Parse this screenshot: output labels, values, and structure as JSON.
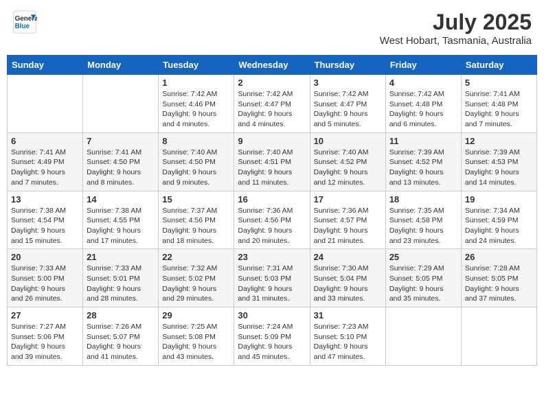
{
  "header": {
    "logo_general": "General",
    "logo_blue": "Blue",
    "month_year": "July 2025",
    "location": "West Hobart, Tasmania, Australia"
  },
  "weekdays": [
    "Sunday",
    "Monday",
    "Tuesday",
    "Wednesday",
    "Thursday",
    "Friday",
    "Saturday"
  ],
  "weeks": [
    [
      {
        "day": "",
        "info": ""
      },
      {
        "day": "",
        "info": ""
      },
      {
        "day": "1",
        "info": "Sunrise: 7:42 AM\nSunset: 4:46 PM\nDaylight: 9 hours and 4 minutes."
      },
      {
        "day": "2",
        "info": "Sunrise: 7:42 AM\nSunset: 4:47 PM\nDaylight: 9 hours and 4 minutes."
      },
      {
        "day": "3",
        "info": "Sunrise: 7:42 AM\nSunset: 4:47 PM\nDaylight: 9 hours and 5 minutes."
      },
      {
        "day": "4",
        "info": "Sunrise: 7:42 AM\nSunset: 4:48 PM\nDaylight: 9 hours and 6 minutes."
      },
      {
        "day": "5",
        "info": "Sunrise: 7:41 AM\nSunset: 4:48 PM\nDaylight: 9 hours and 7 minutes."
      }
    ],
    [
      {
        "day": "6",
        "info": "Sunrise: 7:41 AM\nSunset: 4:49 PM\nDaylight: 9 hours and 7 minutes."
      },
      {
        "day": "7",
        "info": "Sunrise: 7:41 AM\nSunset: 4:50 PM\nDaylight: 9 hours and 8 minutes."
      },
      {
        "day": "8",
        "info": "Sunrise: 7:40 AM\nSunset: 4:50 PM\nDaylight: 9 hours and 9 minutes."
      },
      {
        "day": "9",
        "info": "Sunrise: 7:40 AM\nSunset: 4:51 PM\nDaylight: 9 hours and 11 minutes."
      },
      {
        "day": "10",
        "info": "Sunrise: 7:40 AM\nSunset: 4:52 PM\nDaylight: 9 hours and 12 minutes."
      },
      {
        "day": "11",
        "info": "Sunrise: 7:39 AM\nSunset: 4:52 PM\nDaylight: 9 hours and 13 minutes."
      },
      {
        "day": "12",
        "info": "Sunrise: 7:39 AM\nSunset: 4:53 PM\nDaylight: 9 hours and 14 minutes."
      }
    ],
    [
      {
        "day": "13",
        "info": "Sunrise: 7:38 AM\nSunset: 4:54 PM\nDaylight: 9 hours and 15 minutes."
      },
      {
        "day": "14",
        "info": "Sunrise: 7:38 AM\nSunset: 4:55 PM\nDaylight: 9 hours and 17 minutes."
      },
      {
        "day": "15",
        "info": "Sunrise: 7:37 AM\nSunset: 4:56 PM\nDaylight: 9 hours and 18 minutes."
      },
      {
        "day": "16",
        "info": "Sunrise: 7:36 AM\nSunset: 4:56 PM\nDaylight: 9 hours and 20 minutes."
      },
      {
        "day": "17",
        "info": "Sunrise: 7:36 AM\nSunset: 4:57 PM\nDaylight: 9 hours and 21 minutes."
      },
      {
        "day": "18",
        "info": "Sunrise: 7:35 AM\nSunset: 4:58 PM\nDaylight: 9 hours and 23 minutes."
      },
      {
        "day": "19",
        "info": "Sunrise: 7:34 AM\nSunset: 4:59 PM\nDaylight: 9 hours and 24 minutes."
      }
    ],
    [
      {
        "day": "20",
        "info": "Sunrise: 7:33 AM\nSunset: 5:00 PM\nDaylight: 9 hours and 26 minutes."
      },
      {
        "day": "21",
        "info": "Sunrise: 7:33 AM\nSunset: 5:01 PM\nDaylight: 9 hours and 28 minutes."
      },
      {
        "day": "22",
        "info": "Sunrise: 7:32 AM\nSunset: 5:02 PM\nDaylight: 9 hours and 29 minutes."
      },
      {
        "day": "23",
        "info": "Sunrise: 7:31 AM\nSunset: 5:03 PM\nDaylight: 9 hours and 31 minutes."
      },
      {
        "day": "24",
        "info": "Sunrise: 7:30 AM\nSunset: 5:04 PM\nDaylight: 9 hours and 33 minutes."
      },
      {
        "day": "25",
        "info": "Sunrise: 7:29 AM\nSunset: 5:05 PM\nDaylight: 9 hours and 35 minutes."
      },
      {
        "day": "26",
        "info": "Sunrise: 7:28 AM\nSunset: 5:05 PM\nDaylight: 9 hours and 37 minutes."
      }
    ],
    [
      {
        "day": "27",
        "info": "Sunrise: 7:27 AM\nSunset: 5:06 PM\nDaylight: 9 hours and 39 minutes."
      },
      {
        "day": "28",
        "info": "Sunrise: 7:26 AM\nSunset: 5:07 PM\nDaylight: 9 hours and 41 minutes."
      },
      {
        "day": "29",
        "info": "Sunrise: 7:25 AM\nSunset: 5:08 PM\nDaylight: 9 hours and 43 minutes."
      },
      {
        "day": "30",
        "info": "Sunrise: 7:24 AM\nSunset: 5:09 PM\nDaylight: 9 hours and 45 minutes."
      },
      {
        "day": "31",
        "info": "Sunrise: 7:23 AM\nSunset: 5:10 PM\nDaylight: 9 hours and 47 minutes."
      },
      {
        "day": "",
        "info": ""
      },
      {
        "day": "",
        "info": ""
      }
    ]
  ]
}
